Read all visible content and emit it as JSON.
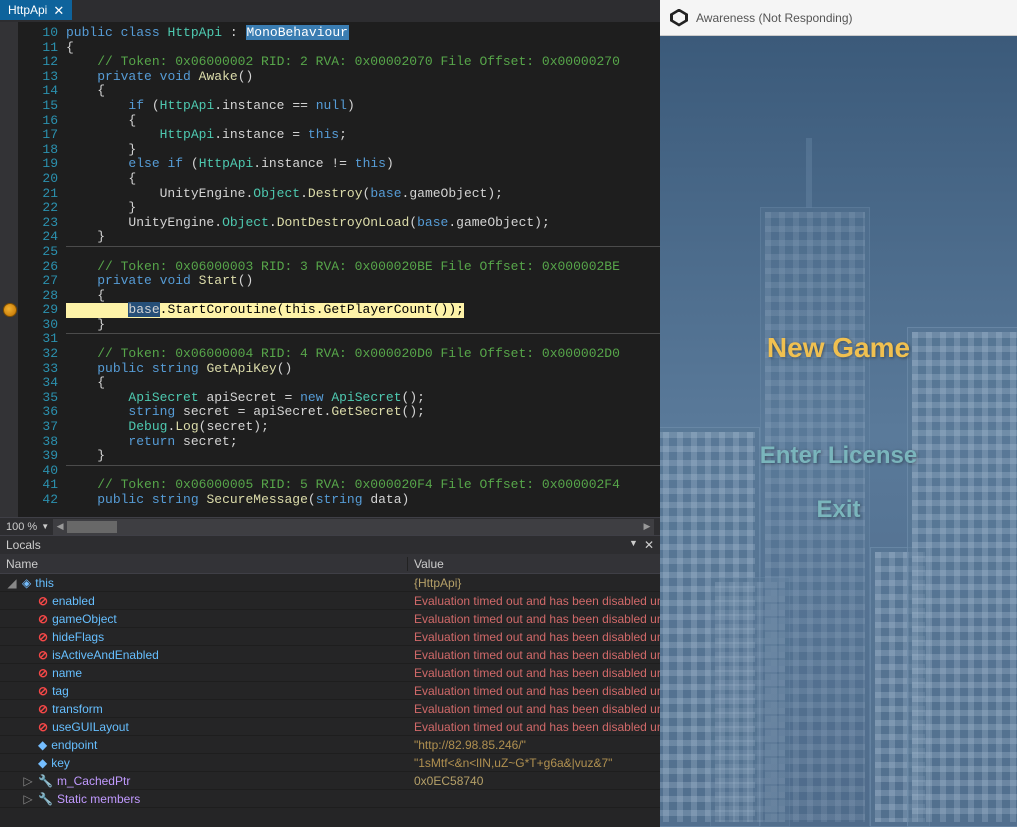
{
  "tab": {
    "title": "HttpApi",
    "close": "✕"
  },
  "zoom": "100 %",
  "code": {
    "lines": [
      {
        "n": 10,
        "tokens": [
          [
            "kw",
            "public"
          ],
          [
            "sp",
            " "
          ],
          [
            "kw",
            "class"
          ],
          [
            "sp",
            " "
          ],
          [
            "type",
            "HttpApi"
          ],
          [
            "sp",
            " "
          ],
          [
            "ident",
            ":"
          ],
          [
            "sp",
            " "
          ],
          [
            "monohi",
            "MonoBehaviour"
          ]
        ]
      },
      {
        "n": 11,
        "tokens": [
          [
            "ident",
            "{"
          ]
        ]
      },
      {
        "n": 12,
        "tokens": [
          [
            "sp",
            "    "
          ],
          [
            "comment",
            "// Token: 0x06000002 RID: 2 RVA: 0x00002070 File Offset: 0x00000270"
          ]
        ]
      },
      {
        "n": 13,
        "tokens": [
          [
            "sp",
            "    "
          ],
          [
            "kw",
            "private"
          ],
          [
            "sp",
            " "
          ],
          [
            "kw",
            "void"
          ],
          [
            "sp",
            " "
          ],
          [
            "method",
            "Awake"
          ],
          [
            "ident",
            "()"
          ]
        ]
      },
      {
        "n": 14,
        "tokens": [
          [
            "sp",
            "    "
          ],
          [
            "ident",
            "{"
          ]
        ]
      },
      {
        "n": 15,
        "tokens": [
          [
            "sp",
            "        "
          ],
          [
            "kw",
            "if"
          ],
          [
            "sp",
            " "
          ],
          [
            "ident",
            "("
          ],
          [
            "type",
            "HttpApi"
          ],
          [
            "ident",
            "."
          ],
          [
            "ident",
            "instance"
          ],
          [
            "sp",
            " "
          ],
          [
            "ident",
            "=="
          ],
          [
            "sp",
            " "
          ],
          [
            "kw",
            "null"
          ],
          [
            "ident",
            ")"
          ]
        ]
      },
      {
        "n": 16,
        "tokens": [
          [
            "sp",
            "        "
          ],
          [
            "ident",
            "{"
          ]
        ]
      },
      {
        "n": 17,
        "tokens": [
          [
            "sp",
            "            "
          ],
          [
            "type",
            "HttpApi"
          ],
          [
            "ident",
            "."
          ],
          [
            "ident",
            "instance"
          ],
          [
            "sp",
            " "
          ],
          [
            "ident",
            "="
          ],
          [
            "sp",
            " "
          ],
          [
            "kw",
            "this"
          ],
          [
            "ident",
            ";"
          ]
        ]
      },
      {
        "n": 18,
        "tokens": [
          [
            "sp",
            "        "
          ],
          [
            "ident",
            "}"
          ]
        ]
      },
      {
        "n": 19,
        "tokens": [
          [
            "sp",
            "        "
          ],
          [
            "kw",
            "else"
          ],
          [
            "sp",
            " "
          ],
          [
            "kw",
            "if"
          ],
          [
            "sp",
            " "
          ],
          [
            "ident",
            "("
          ],
          [
            "type",
            "HttpApi"
          ],
          [
            "ident",
            "."
          ],
          [
            "ident",
            "instance"
          ],
          [
            "sp",
            " "
          ],
          [
            "ident",
            "!="
          ],
          [
            "sp",
            " "
          ],
          [
            "kw",
            "this"
          ],
          [
            "ident",
            ")"
          ]
        ]
      },
      {
        "n": 20,
        "tokens": [
          [
            "sp",
            "        "
          ],
          [
            "ident",
            "{"
          ]
        ]
      },
      {
        "n": 21,
        "tokens": [
          [
            "sp",
            "            "
          ],
          [
            "ident",
            "UnityEngine"
          ],
          [
            "ident",
            "."
          ],
          [
            "type",
            "Object"
          ],
          [
            "ident",
            "."
          ],
          [
            "method",
            "Destroy"
          ],
          [
            "ident",
            "("
          ],
          [
            "kw",
            "base"
          ],
          [
            "ident",
            "."
          ],
          [
            "ident",
            "gameObject"
          ],
          [
            "ident",
            ");"
          ]
        ]
      },
      {
        "n": 22,
        "tokens": [
          [
            "sp",
            "        "
          ],
          [
            "ident",
            "}"
          ]
        ]
      },
      {
        "n": 23,
        "tokens": [
          [
            "sp",
            "        "
          ],
          [
            "ident",
            "UnityEngine"
          ],
          [
            "ident",
            "."
          ],
          [
            "type",
            "Object"
          ],
          [
            "ident",
            "."
          ],
          [
            "method",
            "DontDestroyOnLoad"
          ],
          [
            "ident",
            "("
          ],
          [
            "kw",
            "base"
          ],
          [
            "ident",
            "."
          ],
          [
            "ident",
            "gameObject"
          ],
          [
            "ident",
            ");"
          ]
        ]
      },
      {
        "n": 24,
        "tokens": [
          [
            "sp",
            "    "
          ],
          [
            "ident",
            "}"
          ]
        ],
        "sep": true
      },
      {
        "n": 25,
        "tokens": []
      },
      {
        "n": 26,
        "tokens": [
          [
            "sp",
            "    "
          ],
          [
            "comment",
            "// Token: 0x06000003 RID: 3 RVA: 0x000020BE File Offset: 0x000002BE"
          ]
        ]
      },
      {
        "n": 27,
        "tokens": [
          [
            "sp",
            "    "
          ],
          [
            "kw",
            "private"
          ],
          [
            "sp",
            " "
          ],
          [
            "kw",
            "void"
          ],
          [
            "sp",
            " "
          ],
          [
            "method",
            "Start"
          ],
          [
            "ident",
            "()"
          ]
        ]
      },
      {
        "n": 28,
        "tokens": [
          [
            "sp",
            "    "
          ],
          [
            "ident",
            "{"
          ]
        ]
      },
      {
        "n": 29,
        "exec": true,
        "tokens": [
          [
            "sp",
            "        "
          ],
          [
            "basehi",
            "base"
          ],
          [
            "ident",
            "."
          ],
          [
            "method",
            "StartCoroutine"
          ],
          [
            "ident",
            "("
          ],
          [
            "kw",
            "this"
          ],
          [
            "ident",
            "."
          ],
          [
            "method",
            "GetPlayerCount"
          ],
          [
            "ident",
            "());"
          ]
        ]
      },
      {
        "n": 30,
        "tokens": [
          [
            "sp",
            "    "
          ],
          [
            "ident",
            "}"
          ]
        ],
        "sep": true
      },
      {
        "n": 31,
        "tokens": []
      },
      {
        "n": 32,
        "tokens": [
          [
            "sp",
            "    "
          ],
          [
            "comment",
            "// Token: 0x06000004 RID: 4 RVA: 0x000020D0 File Offset: 0x000002D0"
          ]
        ]
      },
      {
        "n": 33,
        "tokens": [
          [
            "sp",
            "    "
          ],
          [
            "kw",
            "public"
          ],
          [
            "sp",
            " "
          ],
          [
            "kw",
            "string"
          ],
          [
            "sp",
            " "
          ],
          [
            "method",
            "GetApiKey"
          ],
          [
            "ident",
            "()"
          ]
        ]
      },
      {
        "n": 34,
        "tokens": [
          [
            "sp",
            "    "
          ],
          [
            "ident",
            "{"
          ]
        ]
      },
      {
        "n": 35,
        "tokens": [
          [
            "sp",
            "        "
          ],
          [
            "type",
            "ApiSecret"
          ],
          [
            "sp",
            " "
          ],
          [
            "ident",
            "apiSecret"
          ],
          [
            "sp",
            " "
          ],
          [
            "ident",
            "="
          ],
          [
            "sp",
            " "
          ],
          [
            "kw",
            "new"
          ],
          [
            "sp",
            " "
          ],
          [
            "type",
            "ApiSecret"
          ],
          [
            "ident",
            "();"
          ]
        ]
      },
      {
        "n": 36,
        "tokens": [
          [
            "sp",
            "        "
          ],
          [
            "kw",
            "string"
          ],
          [
            "sp",
            " "
          ],
          [
            "ident",
            "secret"
          ],
          [
            "sp",
            " "
          ],
          [
            "ident",
            "="
          ],
          [
            "sp",
            " "
          ],
          [
            "ident",
            "apiSecret"
          ],
          [
            "ident",
            "."
          ],
          [
            "method",
            "GetSecret"
          ],
          [
            "ident",
            "();"
          ]
        ]
      },
      {
        "n": 37,
        "tokens": [
          [
            "sp",
            "        "
          ],
          [
            "type",
            "Debug"
          ],
          [
            "ident",
            "."
          ],
          [
            "method",
            "Log"
          ],
          [
            "ident",
            "("
          ],
          [
            "ident",
            "secret"
          ],
          [
            "ident",
            ");"
          ]
        ]
      },
      {
        "n": 38,
        "tokens": [
          [
            "sp",
            "        "
          ],
          [
            "kw",
            "return"
          ],
          [
            "sp",
            " "
          ],
          [
            "ident",
            "secret"
          ],
          [
            "ident",
            ";"
          ]
        ]
      },
      {
        "n": 39,
        "tokens": [
          [
            "sp",
            "    "
          ],
          [
            "ident",
            "}"
          ]
        ],
        "sep": true
      },
      {
        "n": 40,
        "tokens": []
      },
      {
        "n": 41,
        "tokens": [
          [
            "sp",
            "    "
          ],
          [
            "comment",
            "// Token: 0x06000005 RID: 5 RVA: 0x000020F4 File Offset: 0x000002F4"
          ]
        ]
      },
      {
        "n": 42,
        "tokens": [
          [
            "sp",
            "    "
          ],
          [
            "kw",
            "public"
          ],
          [
            "sp",
            " "
          ],
          [
            "kw",
            "string"
          ],
          [
            "sp",
            " "
          ],
          [
            "method",
            "SecureMessage"
          ],
          [
            "ident",
            "("
          ],
          [
            "kw",
            "string"
          ],
          [
            "sp",
            " "
          ],
          [
            "ident",
            "data"
          ],
          [
            "ident",
            ")"
          ]
        ]
      }
    ]
  },
  "locals": {
    "title": "Locals",
    "columns": {
      "name": "Name",
      "value": "Value"
    },
    "this_label": "this",
    "this_type": "{HttpApi}",
    "timeout_msg": "Evaluation timed out and has been disabled un",
    "error_props": [
      "enabled",
      "gameObject",
      "hideFlags",
      "isActiveAndEnabled",
      "name",
      "tag",
      "transform",
      "useGUILayout"
    ],
    "fields": [
      {
        "name": "endpoint",
        "value": "\"http://82.98.85.246/\""
      },
      {
        "name": "key",
        "value": "\"1sMtf<&n<lIN,uZ~G*T+g6a&|vuz&7\""
      }
    ],
    "cached_ptr": {
      "name": "m_CachedPtr",
      "value": "0x0EC58740"
    },
    "static": "Static members"
  },
  "unity": {
    "title": "Awareness (Not Responding)"
  },
  "menu": {
    "new": "New Game",
    "license": "Enter License",
    "exit": "Exit"
  }
}
